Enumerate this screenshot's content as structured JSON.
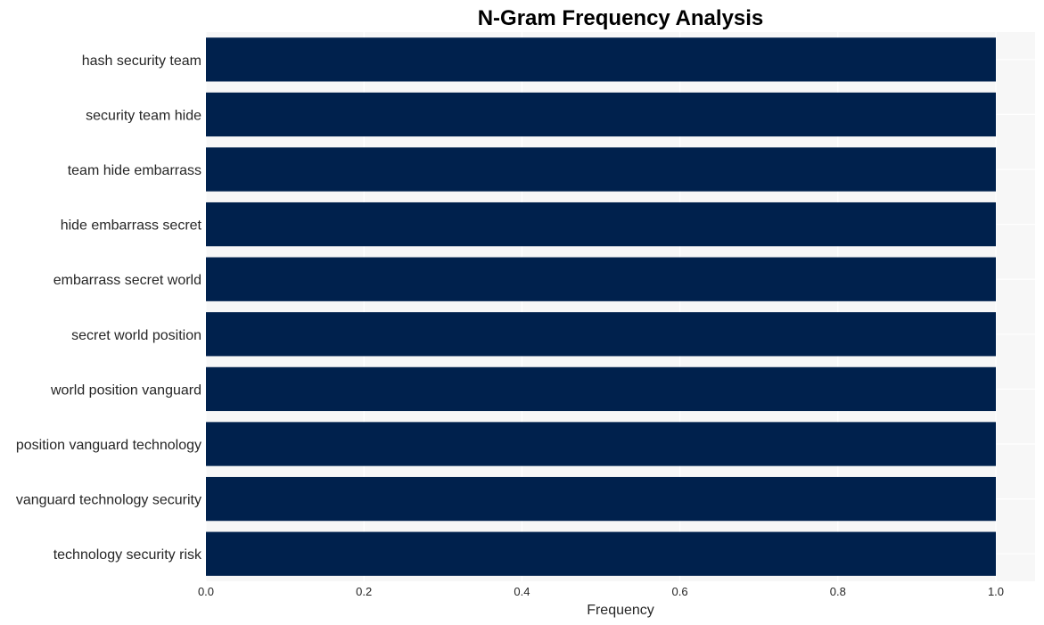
{
  "chart_data": {
    "type": "bar",
    "orientation": "horizontal",
    "title": "N-Gram Frequency Analysis",
    "xlabel": "Frequency",
    "ylabel": "",
    "categories": [
      "hash security team",
      "security team hide",
      "team hide embarrass",
      "hide embarrass secret",
      "embarrass secret world",
      "secret world position",
      "world position vanguard",
      "position vanguard technology",
      "vanguard technology security",
      "technology security risk"
    ],
    "values": [
      1,
      1,
      1,
      1,
      1,
      1,
      1,
      1,
      1,
      1
    ],
    "xlim": [
      0,
      1.05
    ],
    "xticks": [
      "0.0",
      "0.2",
      "0.4",
      "0.6",
      "0.8",
      "1.0"
    ],
    "grid": true,
    "legend": "none",
    "colors": {
      "bar": "#00214d",
      "plot_background": "#f7f7f7",
      "grid": "#ffffff"
    }
  }
}
